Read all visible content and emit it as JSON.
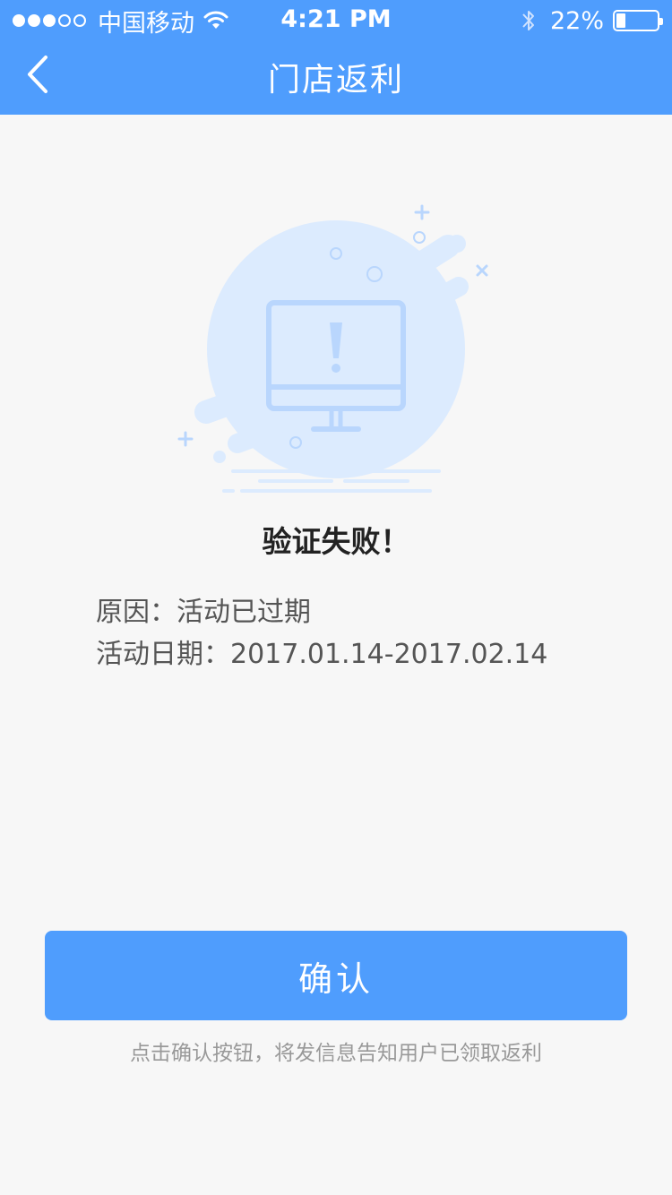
{
  "status_bar": {
    "carrier": "中国移动",
    "time": "4:21 PM",
    "battery": "22%",
    "battery_level": 0.22,
    "signal_bars_filled": 3,
    "signal_bars_total": 5
  },
  "nav": {
    "title": "门店返利",
    "back_icon": "chevron-left-icon"
  },
  "result": {
    "icon": "monitor-warning-icon",
    "title": "验证失败！",
    "reason_label": "原因：",
    "reason_value": "活动已过期",
    "date_label": "活动日期：",
    "date_value": "2017.01.14-2017.02.14"
  },
  "actions": {
    "confirm_label": "确认",
    "hint": "点击确认按钮，将发信息告知用户已领取返利"
  },
  "colors": {
    "primary": "#4f9dfd",
    "background": "#f7f7f7",
    "illustration_light": "#dcebfe",
    "illustration_line": "#b9d6fd"
  }
}
